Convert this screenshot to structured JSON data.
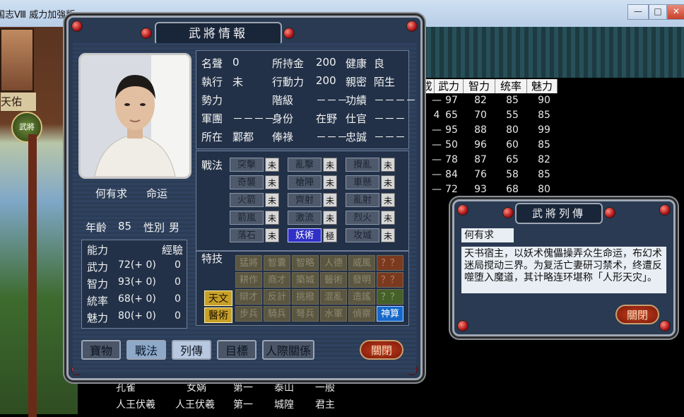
{
  "window": {
    "title": "国志Ⅷ 威力加強版",
    "min": "—",
    "max": "□",
    "close": "✕"
  },
  "background": {
    "left_name": "天佑",
    "left_button": "武將",
    "table_headers": [
      "成",
      "武力",
      "智力",
      "统率",
      "魅力"
    ],
    "table_rows": [
      [
        "—",
        "97",
        "82",
        "85",
        "90"
      ],
      [
        "4",
        "65",
        "70",
        "55",
        "85"
      ],
      [
        "—",
        "95",
        "88",
        "80",
        "99"
      ],
      [
        "—",
        "50",
        "96",
        "60",
        "85"
      ],
      [
        "—",
        "78",
        "87",
        "65",
        "82"
      ],
      [
        "—",
        "84",
        "76",
        "58",
        "85"
      ],
      [
        "—",
        "72",
        "93",
        "68",
        "80"
      ]
    ],
    "bottom_rows": [
      [
        "孔雀",
        "女娲",
        "第一",
        "泰山",
        "一般"
      ],
      [
        "人王伏羲",
        "人王伏羲",
        "第一",
        "城隍",
        "君主"
      ]
    ]
  },
  "officer": {
    "dialog_title": "武將情報",
    "name": "何有求",
    "epithet": "命运",
    "age_label": "年齡",
    "age": "85",
    "gender_label": "性別",
    "gender": "男",
    "fields": [
      {
        "label": "名聲",
        "value": "0"
      },
      {
        "label": "所持金",
        "value": "200"
      },
      {
        "label": "健康",
        "value": "良"
      },
      {
        "label": "執行",
        "value": "未"
      },
      {
        "label": "行動力",
        "value": "200"
      },
      {
        "label": "親密",
        "value": "陌生"
      },
      {
        "label": "勢力",
        "value": ""
      },
      {
        "label": "階級",
        "value": "－－－"
      },
      {
        "label": "功績",
        "value": "－－－－"
      },
      {
        "label": "軍團",
        "value": "－－－－"
      },
      {
        "label": "身份",
        "value": "在野"
      },
      {
        "label": "仕官",
        "value": "－－－"
      },
      {
        "label": "所在",
        "value": "鄴都"
      },
      {
        "label": "俸祿",
        "value": "－－－"
      },
      {
        "label": "忠誠",
        "value": "－－－"
      }
    ],
    "abilities_header": "能力",
    "exp_header": "經驗",
    "abilities": [
      {
        "label": "武力",
        "value": "72(+ 0)",
        "exp": "0"
      },
      {
        "label": "智力",
        "value": "93(+ 0)",
        "exp": "0"
      },
      {
        "label": "統率",
        "value": "68(+ 0)",
        "exp": "0"
      },
      {
        "label": "魅力",
        "value": "80(+ 0)",
        "exp": "0"
      }
    ],
    "tactics_label": "戰法",
    "tactics": [
      {
        "name": "突擊",
        "mark": "未",
        "on": false
      },
      {
        "name": "亂擊",
        "mark": "未",
        "on": false
      },
      {
        "name": "攪亂",
        "mark": "未",
        "on": false
      },
      {
        "name": "奇襲",
        "mark": "未",
        "on": false
      },
      {
        "name": "槍陣",
        "mark": "未",
        "on": false
      },
      {
        "name": "車懸",
        "mark": "未",
        "on": false
      },
      {
        "name": "火箭",
        "mark": "未",
        "on": false
      },
      {
        "name": "齊射",
        "mark": "未",
        "on": false
      },
      {
        "name": "亂射",
        "mark": "未",
        "on": false
      },
      {
        "name": "箭嵐",
        "mark": "未",
        "on": false
      },
      {
        "name": "激流",
        "mark": "未",
        "on": false
      },
      {
        "name": "烈火",
        "mark": "未",
        "on": false
      },
      {
        "name": "落石",
        "mark": "未",
        "on": false
      },
      {
        "name": "妖術",
        "mark": "極",
        "on": true
      },
      {
        "name": "攻城",
        "mark": "未",
        "on": false
      }
    ],
    "traits_label": "特技",
    "traits_row1": [
      "猛將",
      "智囊",
      "智略",
      "人德",
      "威風",
      "？？"
    ],
    "traits_row2": [
      "耕作",
      "商才",
      "築城",
      "醫術",
      "發明",
      "？？"
    ],
    "traits_row3": [
      "辯才",
      "反計",
      "挑撥",
      "混亂",
      "造謠",
      "？？"
    ],
    "traits_row4": [
      "步兵",
      "騎兵",
      "弩兵",
      "水軍",
      "偵察",
      "神算"
    ],
    "gold_traits": [
      "天文",
      "醫術"
    ],
    "tabs": [
      "寶物",
      "戰法",
      "列傳",
      "目標",
      "人際關係"
    ],
    "close": "關閉"
  },
  "bio": {
    "title": "武將列傳",
    "name": "何有求",
    "text": "天书宿主，以妖术傀儡操弄众生命运，布幻术迷局搅动三界。为复活亡妻研习禁术，终遭反噬堕入魔道，其计略连环堪称「人形天灾」。",
    "close": "關閉"
  },
  "colors": {
    "panel": "#2a3a52",
    "accent_blue": "#3030c8",
    "gold": "#c8a028",
    "close_red": "#b02814"
  }
}
